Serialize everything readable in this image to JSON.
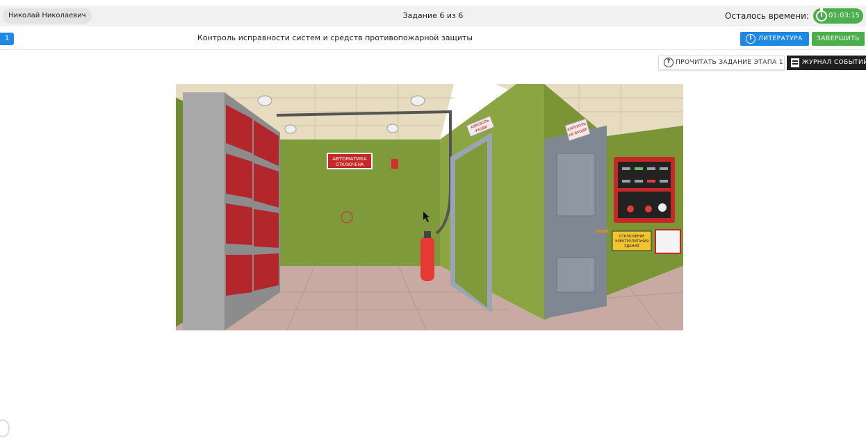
{
  "header": {
    "user_name": "Николай Николаевич",
    "task_counter": "Задание 6 из 6",
    "time_left_label": "Осталось времени:",
    "timer_value": "01:03:15"
  },
  "subheader": {
    "stage_number": "1",
    "title": "Контроль исправности систем и средств противопожарной защиты",
    "literature_label": "ЛИТЕРАТУРА",
    "finish_label": "ЗАВЕРШИТЬ"
  },
  "toolbar": {
    "read_task_label": "ПРОЧИТАТЬ ЗАДАНИЕ ЭТАПА 1",
    "events_log_label": "ЖУРНАЛ СОБЫТИЙ"
  },
  "scene": {
    "automation_sign_line1": "АВТОМАТИКА",
    "automation_sign_line2": "ОТКЛЮЧЕНА",
    "aerosol_sign_line1": "АЭРОЗОЛЬ",
    "aerosol_sign_line2": "УХОДИ",
    "aerosol_sign2_line1": "АЭРОЗОЛЬ",
    "aerosol_sign2_line2": "НЕ ВХОДИ",
    "power_sign_line1": "ОТКЛЮЧЕНИЕ",
    "power_sign_line2": "ЭЛЕКТРОПИТАНИЯ",
    "power_sign_line3": "ЗДАНИЯ"
  },
  "colors": {
    "accent_blue": "#1e88e5",
    "accent_green": "#4cae4c",
    "wall_green": "#7f9a3a"
  }
}
